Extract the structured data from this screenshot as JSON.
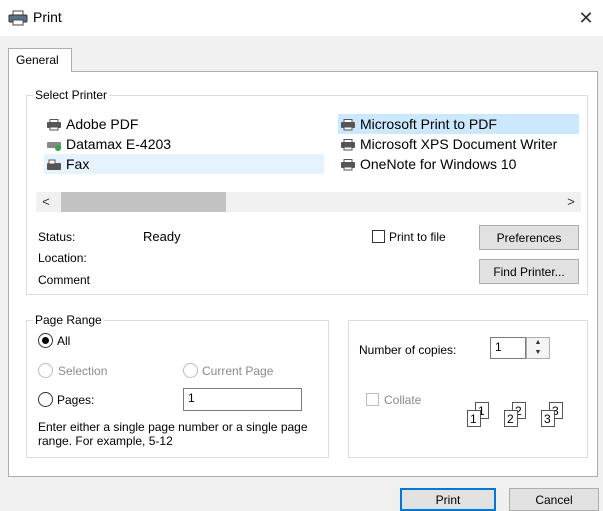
{
  "window": {
    "title": "Print"
  },
  "tabs": [
    {
      "label": "General"
    }
  ],
  "select_printer": {
    "legend": "Select Printer",
    "printers_left": [
      {
        "name": "Adobe PDF"
      },
      {
        "name": "Datamax E-4203"
      },
      {
        "name": "Fax"
      }
    ],
    "printers_right": [
      {
        "name": "Microsoft Print to PDF"
      },
      {
        "name": "Microsoft XPS Document Writer"
      },
      {
        "name": "OneNote for Windows 10"
      }
    ],
    "selected_printer": "Microsoft Print to PDF",
    "status_label": "Status:",
    "status_value": "Ready",
    "location_label": "Location:",
    "comment_label": "Comment",
    "print_to_file_label": "Print to file",
    "preferences_label": "Preferences",
    "find_printer_label": "Find Printer...",
    "scroll_left": "<",
    "scroll_right": ">"
  },
  "page_range": {
    "legend": "Page Range",
    "all_label": "All",
    "selection_label": "Selection",
    "current_page_label": "Current Page",
    "pages_label": "Pages:",
    "pages_value": "1",
    "selected_option": "All",
    "hint": "Enter either a single page number or a single page range.  For example, 5-12"
  },
  "copies": {
    "number_label": "Number of copies:",
    "number_value": "1",
    "collate_label": "Collate",
    "collate_pages": [
      "1",
      "1",
      "2",
      "2",
      "3",
      "3"
    ]
  },
  "footer": {
    "print_label": "Print",
    "cancel_label": "Cancel"
  },
  "colors": {
    "selected_row": "#cce8ff",
    "hover_row": "#e5f3ff",
    "default_button_border": "#0078d7"
  }
}
